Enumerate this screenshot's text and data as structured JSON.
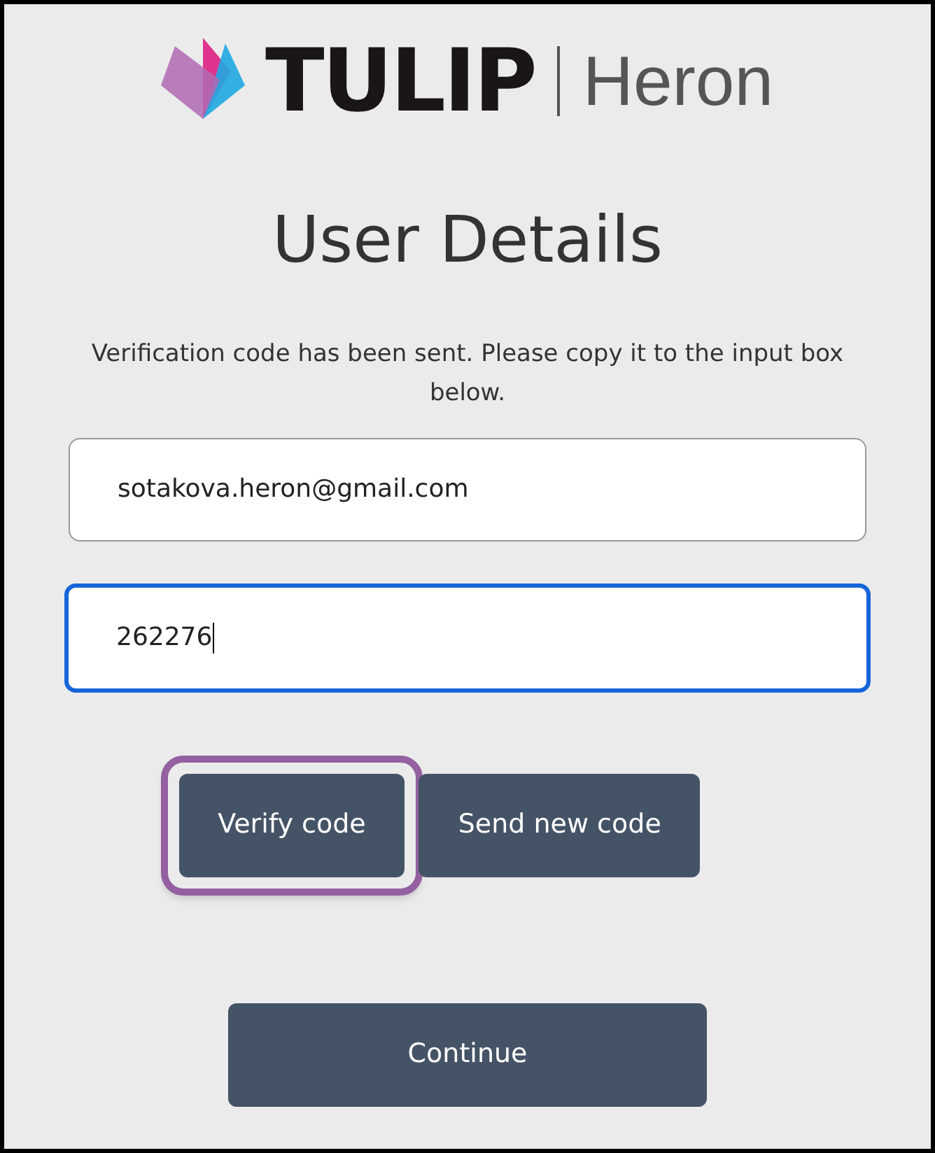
{
  "logo": {
    "brand": "TULIP",
    "product": "Heron"
  },
  "title": "User Details",
  "message": "Verification code has been sent. Please copy it to the input box below.",
  "fields": [
    {
      "value": "sotakova.heron@gmail.com",
      "focused": false
    },
    {
      "value": "262276",
      "focused": true
    }
  ],
  "actions": [
    {
      "label": "Verify code",
      "highlighted": true
    },
    {
      "label": "Send new code",
      "highlighted": false
    }
  ],
  "continue_button": {
    "label": "Continue"
  }
}
